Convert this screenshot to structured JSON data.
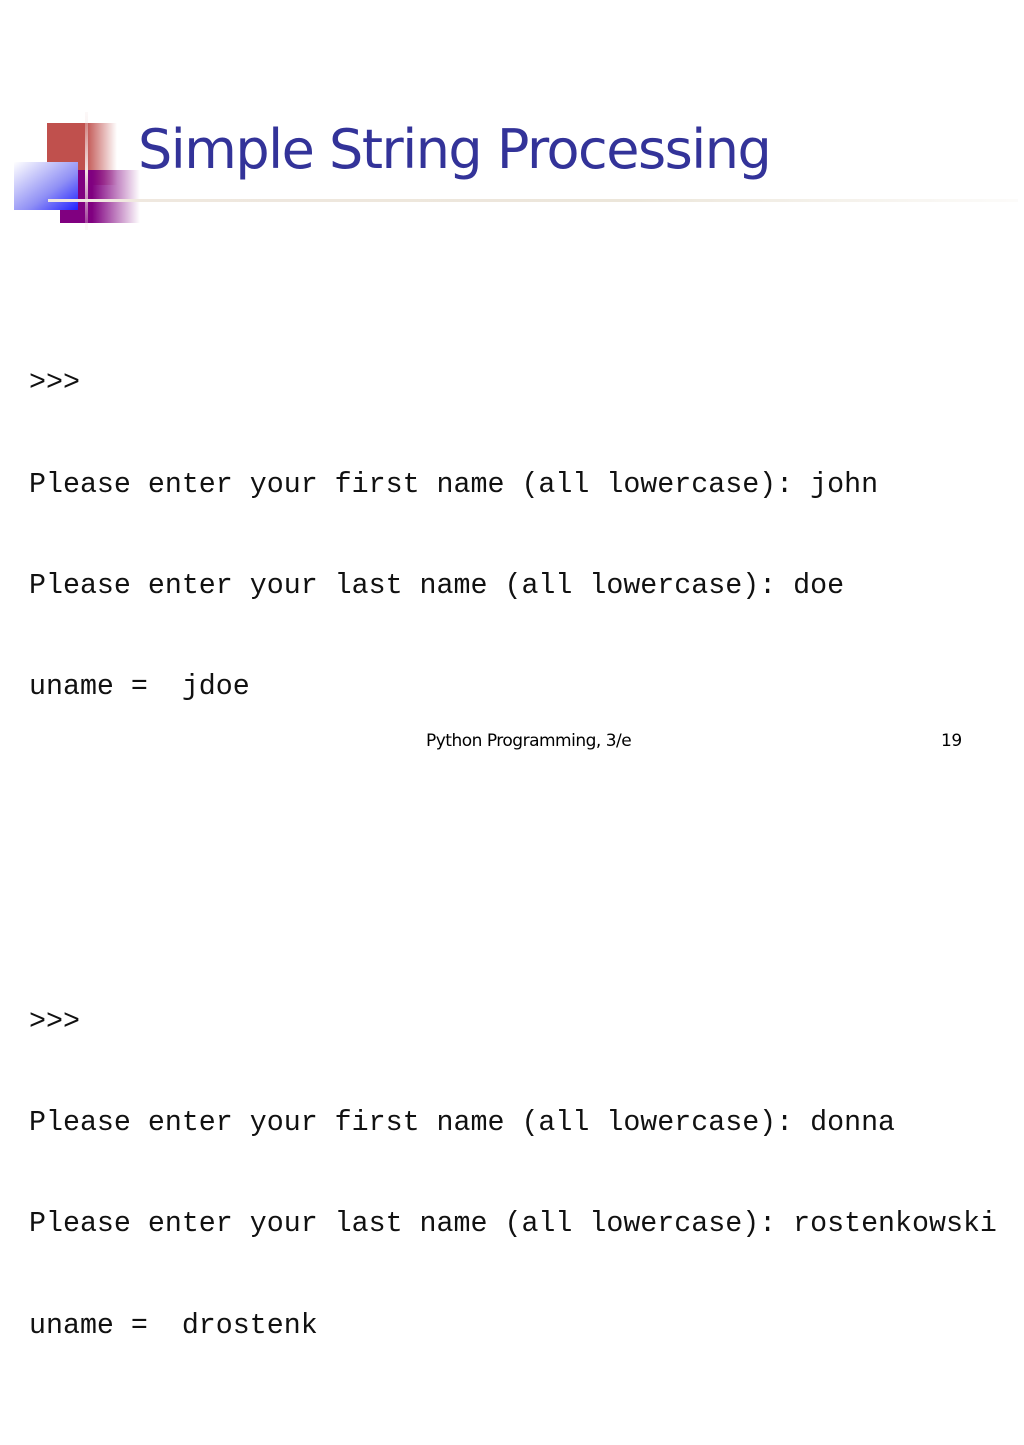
{
  "slide": {
    "title": "Simple String Processing",
    "accent_color": "#333399",
    "code_blocks": [
      {
        "prompt": ">>>",
        "lines": [
          "Please enter your first name (all lowercase): john",
          "Please enter your last name (all lowercase): doe",
          "uname =  jdoe"
        ]
      },
      {
        "prompt": ">>>",
        "lines": [
          "Please enter your first name (all lowercase): donna",
          "Please enter your last name (all lowercase): rostenkowski",
          "uname =  drostenk"
        ]
      }
    ],
    "footer": {
      "text": "Python Programming, 3/e",
      "page_number": "19"
    }
  }
}
